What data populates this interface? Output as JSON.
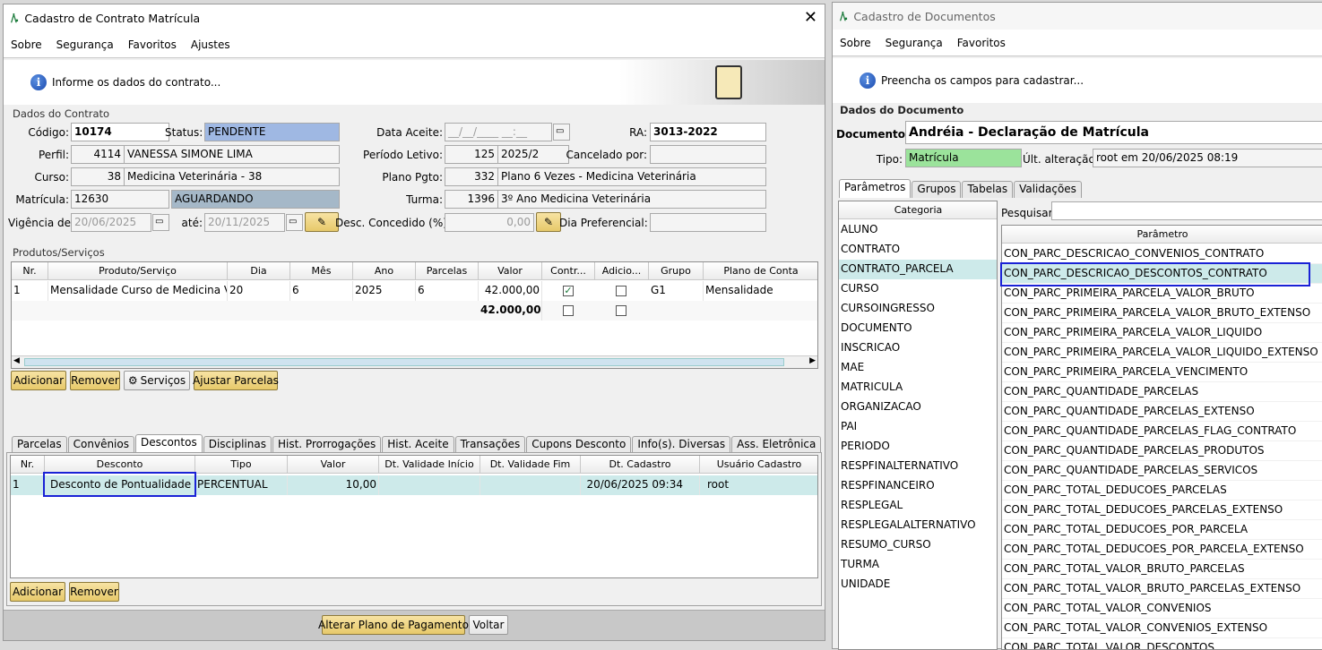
{
  "left_window": {
    "title": "Cadastro de Contrato Matrícula",
    "menu": [
      "Sobre",
      "Segurança",
      "Favoritos",
      "Ajustes"
    ],
    "info_message": "Informe os dados do contrato...",
    "section_contract": "Dados do Contrato",
    "labels": {
      "codigo": "Código:",
      "status": "Status:",
      "data_aceite": "Data Aceite:",
      "ra": "RA:",
      "perfil": "Perfil:",
      "periodo": "Período Letivo:",
      "cancelado": "Cancelado por:",
      "curso": "Curso:",
      "plano": "Plano Pgto:",
      "matricula": "Matrícula:",
      "turma": "Turma:",
      "vigencia": "Vigência de:",
      "ate": "até:",
      "desc": "Desc. Concedido (%):",
      "dia_pref": "Dia Preferencial:"
    },
    "values": {
      "codigo": "10174",
      "status": "PENDENTE",
      "data_aceite": "__/__/____ __:__",
      "ra": "3013-2022",
      "perfil_id": "4114",
      "perfil_nome": "VANESSA SIMONE LIMA",
      "periodo_id": "125",
      "periodo_nome": "2025/2",
      "cancelado": "",
      "curso_id": "38",
      "curso_nome": "Medicina Veterinária - 38",
      "plano_id": "332",
      "plano_nome": "Plano 6 Vezes - Medicina Veterinária",
      "matricula": "12630",
      "matricula_status": "AGUARDANDO",
      "turma_id": "1396",
      "turma_nome": "3º Ano Medicina Veterinária",
      "vigencia_de": "20/06/2025",
      "vigencia_ate": "20/11/2025",
      "desc": "0,00",
      "dia_pref": ""
    },
    "section_products": "Produtos/Serviços",
    "products_headers": [
      "Nr.",
      "Produto/Serviço",
      "Dia",
      "Mês",
      "Ano",
      "Parcelas",
      "Valor",
      "Contr...",
      "Adicio...",
      "Grupo",
      "Plano de Conta"
    ],
    "products_rows": [
      {
        "nr": "1",
        "produto": "Mensalidade Curso de Medicina Ve...",
        "dia": "20",
        "mes": "6",
        "ano": "2025",
        "parcelas": "6",
        "valor": "42.000,00",
        "contr": true,
        "adic": false,
        "grupo": "G1",
        "plano": "Mensalidade"
      }
    ],
    "products_total": "42.000,00",
    "products_buttons": [
      "Adicionar",
      "Remover",
      "Serviços",
      "Ajustar Parcelas"
    ],
    "tabs": [
      "Parcelas",
      "Convênios",
      "Descontos",
      "Disciplinas",
      "Hist. Prorrogações",
      "Hist. Aceite",
      "Transações",
      "Cupons Desconto",
      "Info(s). Diversas",
      "Ass. Eletrônica"
    ],
    "active_tab": "Descontos",
    "desc_headers": [
      "Nr.",
      "Desconto",
      "Tipo",
      "Valor",
      "Dt. Validade Início",
      "Dt. Validade Fim",
      "Dt. Cadastro",
      "Usuário Cadastro"
    ],
    "desc_rows": [
      {
        "nr": "1",
        "desconto": "Desconto de Pontualidade",
        "tipo": "PERCENTUAL",
        "valor": "10,00",
        "ini": "",
        "fim": "",
        "cadastro": "20/06/2025 09:34",
        "usuario": "root"
      }
    ],
    "desc_buttons": [
      "Adicionar",
      "Remover"
    ],
    "footer_buttons": [
      "Alterar Plano de Pagamento",
      "Voltar"
    ]
  },
  "right_window": {
    "title": "Cadastro de Documentos",
    "menu": [
      "Sobre",
      "Segurança",
      "Favoritos"
    ],
    "info_message": "Preencha os campos para cadastrar...",
    "section": "Dados do Documento",
    "documento_label": "Documento:",
    "documento": "Andréia - Declaração de Matrícula",
    "tipo_label": "Tipo:",
    "tipo": "Matrícula",
    "ult_label": "Últ. alteração:",
    "ult": "root em 20/06/2025 08:19",
    "tabs": [
      "Parâmetros",
      "Grupos",
      "Tabelas",
      "Validações"
    ],
    "categoria_header": "Categoria",
    "categories": [
      "ALUNO",
      "CONTRATO",
      "CONTRATO_PARCELA",
      "CURSO",
      "CURSOINGRESSO",
      "DOCUMENTO",
      "INSCRICAO",
      "MAE",
      "MATRICULA",
      "ORGANIZACAO",
      "PAI",
      "PERIODO",
      "RESPFINALTERNATIVO",
      "RESPFINANCEIRO",
      "RESPLEGAL",
      "RESPLEGALALTERNATIVO",
      "RESUMO_CURSO",
      "TURMA",
      "UNIDADE"
    ],
    "selected_category": "CONTRATO_PARCELA",
    "pesquisar_label": "Pesquisar:",
    "param_header": "Parâmetro",
    "params": [
      "CON_PARC_DESCRICAO_CONVENIOS_CONTRATO",
      "CON_PARC_DESCRICAO_DESCONTOS_CONTRATO",
      "CON_PARC_PRIMEIRA_PARCELA_VALOR_BRUTO",
      "CON_PARC_PRIMEIRA_PARCELA_VALOR_BRUTO_EXTENSO",
      "CON_PARC_PRIMEIRA_PARCELA_VALOR_LIQUIDO",
      "CON_PARC_PRIMEIRA_PARCELA_VALOR_LIQUIDO_EXTENSO",
      "CON_PARC_PRIMEIRA_PARCELA_VENCIMENTO",
      "CON_PARC_QUANTIDADE_PARCELAS",
      "CON_PARC_QUANTIDADE_PARCELAS_EXTENSO",
      "CON_PARC_QUANTIDADE_PARCELAS_FLAG_CONTRATO",
      "CON_PARC_QUANTIDADE_PARCELAS_PRODUTOS",
      "CON_PARC_QUANTIDADE_PARCELAS_SERVICOS",
      "CON_PARC_TOTAL_DEDUCOES_PARCELAS",
      "CON_PARC_TOTAL_DEDUCOES_PARCELAS_EXTENSO",
      "CON_PARC_TOTAL_DEDUCOES_POR_PARCELA",
      "CON_PARC_TOTAL_DEDUCOES_POR_PARCELA_EXTENSO",
      "CON_PARC_TOTAL_VALOR_BRUTO_PARCELAS",
      "CON_PARC_TOTAL_VALOR_BRUTO_PARCELAS_EXTENSO",
      "CON_PARC_TOTAL_VALOR_CONVENIOS",
      "CON_PARC_TOTAL_VALOR_CONVENIOS_EXTENSO",
      "CON_PARC_TOTAL_VALOR_DESCONTOS"
    ]
  },
  "colors": {
    "status_blue": "#9fb8e3",
    "aguardando": "#a5b8c8",
    "tipo_green": "#9be39b",
    "row_sel": "#cdeaea",
    "highlight": "#1a22d6"
  }
}
